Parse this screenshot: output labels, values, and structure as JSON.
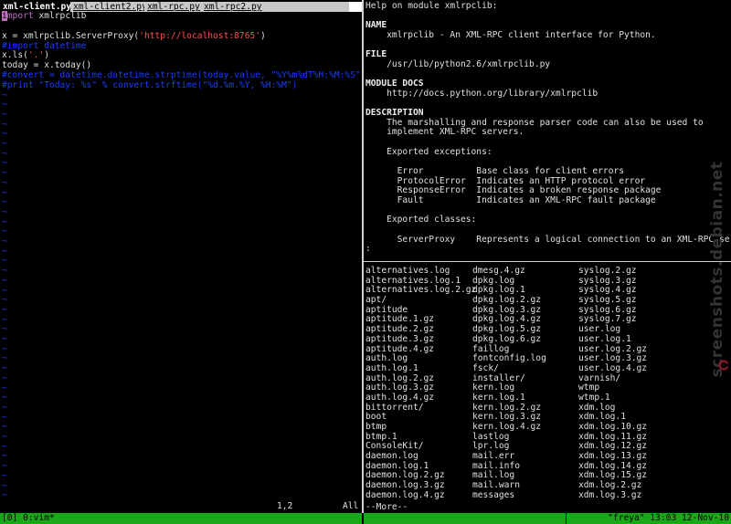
{
  "vim": {
    "tabs": [
      "xml-client.py",
      "xml-client2.py",
      "xml-rpc.py",
      "xml-rpc2.py"
    ],
    "code": {
      "line1_cursor": "i",
      "line1_kw": "mport",
      "line1_rest": " xmlrpclib",
      "line2": "",
      "line3_pre": "x = xmlrpclib.ServerProxy(",
      "line3_str": "'http://localhost:8765'",
      "line3_post": ")",
      "line4_cmt": "#import datetime",
      "line5_pre": "x.ls(",
      "line5_str": "'.'",
      "line5_post": ")",
      "line6": "today = x.today()",
      "line7_cmt": "#convert = datetime.datetime.strptime(today.value, \"%Y%m%dT%H:%M:%S\")",
      "line8_cmt": "#print \"Today: %s\" % convert.strftime(\"%d.%m.%Y, %H:%M\")"
    },
    "tilde": "~",
    "ruler_pos": "1,2",
    "ruler_all": "All"
  },
  "help": {
    "lines": [
      {
        "text": "Help on module xmlrpclib:",
        "bold": false
      },
      {
        "text": "",
        "bold": false
      },
      {
        "text": "NAME",
        "bold": true
      },
      {
        "text": "    xmlrpclib - An XML-RPC client interface for Python.",
        "bold": false
      },
      {
        "text": "",
        "bold": false
      },
      {
        "text": "FILE",
        "bold": true
      },
      {
        "text": "    /usr/lib/python2.6/xmlrpclib.py",
        "bold": false
      },
      {
        "text": "",
        "bold": false
      },
      {
        "text": "MODULE DOCS",
        "bold": true
      },
      {
        "text": "    http://docs.python.org/library/xmlrpclib",
        "bold": false
      },
      {
        "text": "",
        "bold": false
      },
      {
        "text": "DESCRIPTION",
        "bold": true
      },
      {
        "text": "    The marshalling and response parser code can also be used to",
        "bold": false
      },
      {
        "text": "    implement XML-RPC servers.",
        "bold": false
      },
      {
        "text": "",
        "bold": false
      },
      {
        "text": "    Exported exceptions:",
        "bold": false
      },
      {
        "text": "",
        "bold": false
      },
      {
        "text": "      Error          Base class for client errors",
        "bold": false
      },
      {
        "text": "      ProtocolError  Indicates an HTTP protocol error",
        "bold": false
      },
      {
        "text": "      ResponseError  Indicates a broken response package",
        "bold": false
      },
      {
        "text": "      Fault          Indicates an XML-RPC fault package",
        "bold": false
      },
      {
        "text": "",
        "bold": false
      },
      {
        "text": "    Exported classes:",
        "bold": false
      },
      {
        "text": "",
        "bold": false
      },
      {
        "text": "      ServerProxy    Represents a logical connection to an XML-RPC server",
        "bold": false
      },
      {
        "text": ":",
        "bold": false
      }
    ]
  },
  "listing": {
    "col1": [
      "alternatives.log",
      "alternatives.log.1",
      "alternatives.log.2.gz",
      "apt/",
      "aptitude",
      "aptitude.1.gz",
      "aptitude.2.gz",
      "aptitude.3.gz",
      "aptitude.4.gz",
      "auth.log",
      "auth.log.1",
      "auth.log.2.gz",
      "auth.log.3.gz",
      "auth.log.4.gz",
      "bittorrent/",
      "boot",
      "btmp",
      "btmp.1",
      "ConsoleKit/",
      "daemon.log",
      "daemon.log.1",
      "daemon.log.2.gz",
      "daemon.log.3.gz",
      "daemon.log.4.gz"
    ],
    "col2": [
      "dmesg.4.gz",
      "dpkg.log",
      "dpkg.log.1",
      "dpkg.log.2.gz",
      "dpkg.log.3.gz",
      "dpkg.log.4.gz",
      "dpkg.log.5.gz",
      "dpkg.log.6.gz",
      "faillog",
      "fontconfig.log",
      "fsck/",
      "installer/",
      "kern.log",
      "kern.log.1",
      "kern.log.2.gz",
      "kern.log.3.gz",
      "kern.log.4.gz",
      "lastlog",
      "lpr.log",
      "mail.err",
      "mail.info",
      "mail.log",
      "mail.warn",
      "messages"
    ],
    "col3": [
      "syslog.2.gz",
      "syslog.3.gz",
      "syslog.4.gz",
      "syslog.5.gz",
      "syslog.6.gz",
      "syslog.7.gz",
      "user.log",
      "user.log.1",
      "user.log.2.gz",
      "user.log.3.gz",
      "user.log.4.gz",
      "varnish/",
      "wtmp",
      "wtmp.1",
      "xdm.log",
      "xdm.log.1",
      "xdm.log.10.gz",
      "xdm.log.11.gz",
      "xdm.log.12.gz",
      "xdm.log.13.gz",
      "xdm.log.14.gz",
      "xdm.log.15.gz",
      "xdm.log.2.gz",
      "xdm.log.3.gz"
    ],
    "more": "--More--"
  },
  "statusbar": {
    "left": "[0] 0:vim*",
    "right": "\"freya\" 13:03 12-Nov-10"
  },
  "watermark": {
    "text": "screenshots.debian.net"
  },
  "colors": {
    "status_green": "#18a818",
    "keyword": "#c070c0",
    "string": "#ff5050",
    "comment": "#1a3cff"
  }
}
